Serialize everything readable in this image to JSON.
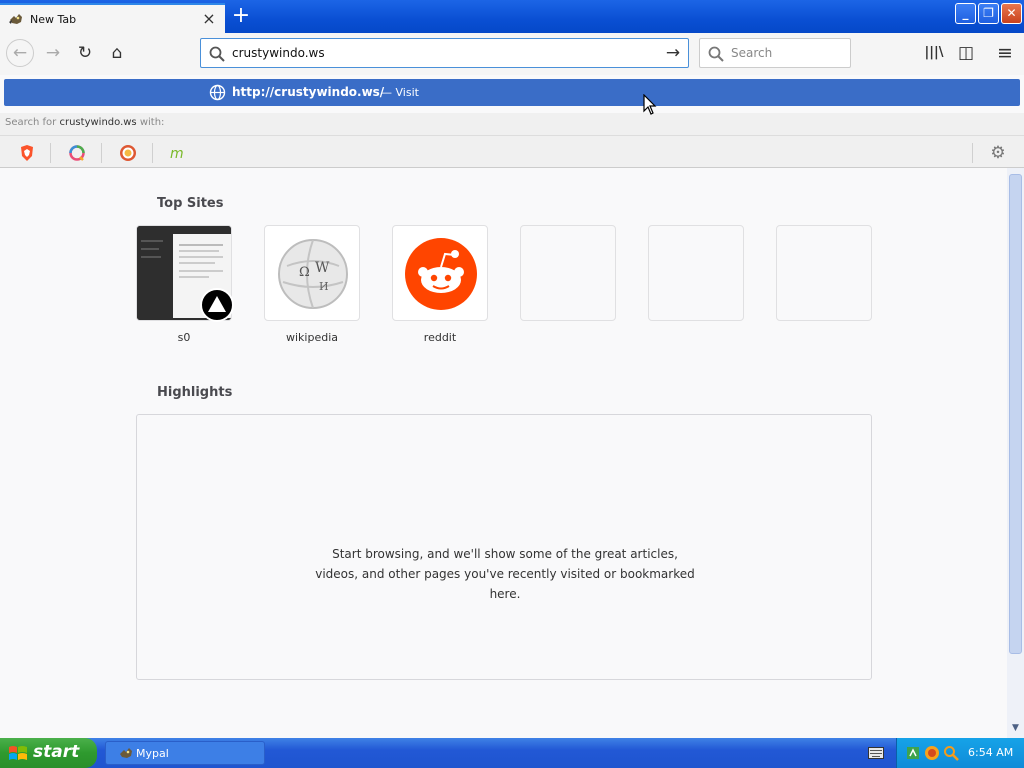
{
  "browser": {
    "tab": {
      "title": "New Tab",
      "close": "×"
    },
    "new_tab": "+",
    "window": {
      "minimize": "_",
      "maximize": "❐",
      "close": "✕"
    },
    "nav": {
      "back": "←",
      "forward": "→",
      "reload": "↻",
      "home": "⌂"
    },
    "urlbar": {
      "value": "crustywindo.ws",
      "go": "→"
    },
    "search": {
      "placeholder": "Search"
    },
    "toolbar": {
      "library": "|||\\",
      "sidebar": "◫",
      "menu": "≡"
    }
  },
  "suggestion": {
    "url": "http://crustywindo.ws/",
    "action": "— Visit"
  },
  "search_with": {
    "prefix": "Search for",
    "query": "crustywindo.ws",
    "suffix": "with:"
  },
  "engines": [
    "brave-search",
    "qwant",
    "duckduckgo",
    "mojeek"
  ],
  "newtab": {
    "top_sites_title": "Top Sites",
    "top_sites": [
      {
        "label": "s0",
        "kind": "screenshot"
      },
      {
        "label": "wikipedia",
        "kind": "wikipedia"
      },
      {
        "label": "reddit",
        "kind": "reddit"
      },
      {
        "label": "",
        "kind": "empty"
      },
      {
        "label": "",
        "kind": "empty"
      },
      {
        "label": "",
        "kind": "empty"
      }
    ],
    "highlights_title": "Highlights",
    "highlights_message": "Start browsing, and we'll show some of the great articles, videos, and other pages you've recently visited or bookmarked here."
  },
  "taskbar": {
    "start": "start",
    "task": "Mypal",
    "clock": "6:54 AM"
  },
  "colors": {
    "accent": "#3a6dc7",
    "reddit": "#ff4500",
    "start_green": "#2e9a2e",
    "taskbar_blue": "#2258d5"
  }
}
